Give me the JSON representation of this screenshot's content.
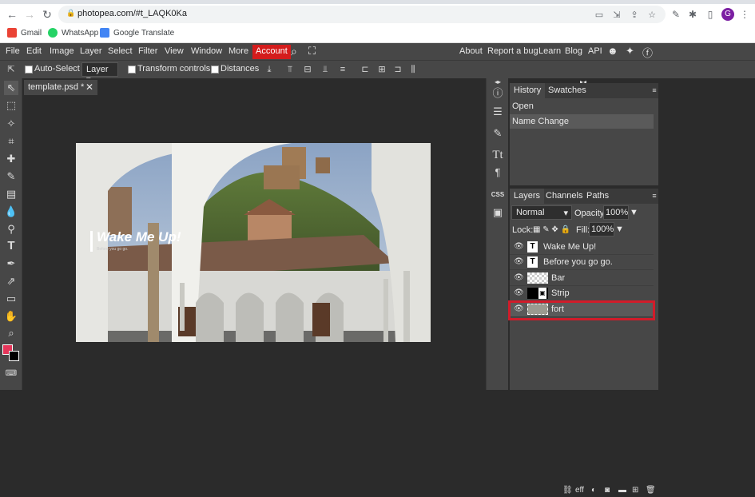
{
  "browser": {
    "url": "photopea.com/#t_LAQK0Ka",
    "avatar_letter": "G",
    "avatar_color": "#7b1fa2",
    "bookmarks": [
      {
        "label": "Gmail",
        "icon": "gmail-icon"
      },
      {
        "label": "WhatsApp",
        "icon": "whatsapp-icon"
      },
      {
        "label": "Google Translate",
        "icon": "translate-icon"
      }
    ]
  },
  "menubar": {
    "items": [
      "File",
      "Edit",
      "Image",
      "Layer",
      "Select",
      "Filter",
      "View",
      "Window",
      "More"
    ],
    "account": "Account",
    "right_items": [
      "About",
      "Report a bug",
      "Learn",
      "Blog",
      "API"
    ],
    "account_color": "#d41c1c"
  },
  "options": {
    "auto_select": "Auto-Select",
    "layer_select": "Layer",
    "transform_controls": "Transform controls",
    "distances": "Distances"
  },
  "document": {
    "tab_title": "template.psd *",
    "canvas_title": "Wake Me Up!",
    "canvas_subtitle": "Before you go go."
  },
  "history_panel": {
    "tabs": [
      "History",
      "Swatches"
    ],
    "items": [
      "Open",
      "Name Change"
    ]
  },
  "layers_panel": {
    "tabs": [
      "Layers",
      "Channels",
      "Paths"
    ],
    "blend_mode": "Normal",
    "opacity_label": "Opacity:",
    "opacity_value": "100%",
    "lock_label": "Lock:",
    "fill_label": "Fill:",
    "fill_value": "100%",
    "layers": [
      {
        "name": "Wake Me Up!",
        "type": "text"
      },
      {
        "name": "Before you go go.",
        "type": "text"
      },
      {
        "name": "Bar",
        "type": "raster"
      },
      {
        "name": "Strip",
        "type": "raster"
      },
      {
        "name": "fort",
        "type": "image",
        "selected": true
      }
    ]
  },
  "colors": {
    "foreground": "#e5365a",
    "background": "#000000",
    "highlight": "#d11c2a"
  }
}
